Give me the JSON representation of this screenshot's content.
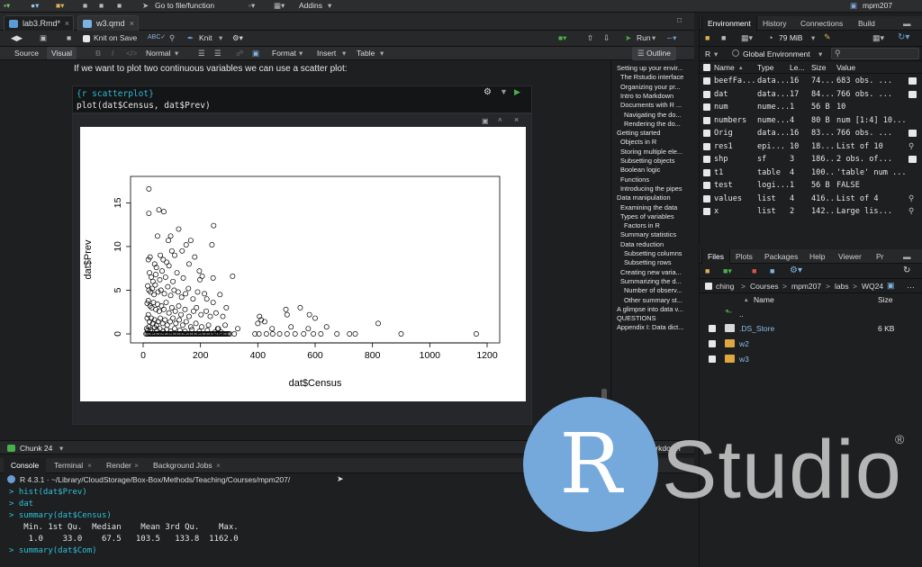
{
  "topbar": {
    "goto_label": "Go to file/function",
    "addins_label": "Addins",
    "project_label": "mpm207"
  },
  "editor": {
    "tabs": [
      {
        "label": "lab3.Rmd*"
      },
      {
        "label": "w3.qmd"
      }
    ],
    "toolbar": {
      "knit_on_save": "Knit on Save",
      "knit": "Knit",
      "run": "Run"
    },
    "toolbar2": {
      "source": "Source",
      "visual": "Visual",
      "normal": "Normal",
      "format": "Format",
      "insert": "Insert",
      "table": "Table",
      "outline": "Outline"
    },
    "doc_text": "If we want to plot two continuous variables we can use a scatter plot:",
    "chunk_header": "{r scatterplot}",
    "chunk_code": "plot(dat$Census, dat$Prev)"
  },
  "outline": [
    {
      "label": "Setting up your envir...",
      "level": 1
    },
    {
      "label": "The Rstudio interface",
      "level": 2
    },
    {
      "label": "Organizing your pr...",
      "level": 2
    },
    {
      "label": "Intro to Markdown",
      "level": 2
    },
    {
      "label": "Documents with R ...",
      "level": 2
    },
    {
      "label": "Navigating the do...",
      "level": 3
    },
    {
      "label": "Rendering the do...",
      "level": 3
    },
    {
      "label": "Getting started",
      "level": 1
    },
    {
      "label": "Objects in R",
      "level": 2
    },
    {
      "label": "Storing multiple ele...",
      "level": 2
    },
    {
      "label": "Subsetting objects",
      "level": 2
    },
    {
      "label": "Boolean logic",
      "level": 2
    },
    {
      "label": "Functions",
      "level": 2
    },
    {
      "label": "Introducing the pipes",
      "level": 2
    },
    {
      "label": "Data manipulation",
      "level": 1
    },
    {
      "label": "Examining the data",
      "level": 2
    },
    {
      "label": "Types of variables",
      "level": 2
    },
    {
      "label": "Factors in R",
      "level": 3
    },
    {
      "label": "Summary statistics",
      "level": 2
    },
    {
      "label": "Data reduction",
      "level": 2
    },
    {
      "label": "Subsetting columns",
      "level": 3
    },
    {
      "label": "Subsetting rows",
      "level": 3
    },
    {
      "label": "Creating new varia...",
      "level": 2
    },
    {
      "label": "Summarizing the d...",
      "level": 2
    },
    {
      "label": "Number of observ...",
      "level": 3
    },
    {
      "label": "Other summary st...",
      "level": 3
    },
    {
      "label": "A glimpse into data v...",
      "level": 1
    },
    {
      "label": "QUESTIONS",
      "level": 1
    },
    {
      "label": "Appendix I: Data dict...",
      "level": 1
    }
  ],
  "status": {
    "chunk": "Chunk 24",
    "mode": "R Markdown"
  },
  "console": {
    "tabs": [
      "Console",
      "Terminal",
      "Render",
      "Background Jobs"
    ],
    "path": "R 4.3.1 · ~/Library/CloudStorage/Box-Box/Methods/Teaching/Courses/mpm207/",
    "lines": [
      {
        "kind": "cmd",
        "text": "> hist(dat$Prev)"
      },
      {
        "kind": "cmd",
        "text": "> dat"
      },
      {
        "kind": "cmd",
        "text": "> summary(dat$Census)"
      },
      {
        "kind": "out",
        "text": "   Min. 1st Qu.  Median    Mean 3rd Qu.    Max. "
      },
      {
        "kind": "out",
        "text": "    1.0    33.0    67.5   103.5   133.8  1162.0 "
      },
      {
        "kind": "cmd",
        "text": "> summary(dat$Com)"
      }
    ]
  },
  "environment": {
    "tabs": [
      "Environment",
      "History",
      "Connections",
      "Build"
    ],
    "memory": "79 MiB",
    "lang": "R",
    "scope": "Global Environment",
    "columns": [
      "Name",
      "Type",
      "Le...",
      "Size",
      "Value"
    ],
    "rows": [
      {
        "name": "beefFa...",
        "type": "data...",
        "len": "16",
        "size": "74...",
        "value": "683 obs. ..."
      },
      {
        "name": "dat",
        "type": "data...",
        "len": "17",
        "size": "84...",
        "value": "766 obs. ..."
      },
      {
        "name": "num",
        "type": "nume...",
        "len": "1",
        "size": "56 B",
        "value": "10"
      },
      {
        "name": "numbers",
        "type": "nume...",
        "len": "4",
        "size": "80 B",
        "value": "num [1:4] 10..."
      },
      {
        "name": "Orig",
        "type": "data...",
        "len": "16",
        "size": "83...",
        "value": "766 obs. ..."
      },
      {
        "name": "res1",
        "type": "epi...",
        "len": "10",
        "size": "18...",
        "value": "List of 10"
      },
      {
        "name": "shp",
        "type": "sf",
        "len": "3",
        "size": "186...",
        "value": "2 obs. of..."
      },
      {
        "name": "t1",
        "type": "table",
        "len": "4",
        "size": "100...",
        "value": "'table' num ..."
      },
      {
        "name": "test",
        "type": "logi...",
        "len": "1",
        "size": "56 B",
        "value": "FALSE"
      },
      {
        "name": "values",
        "type": "list",
        "len": "4",
        "size": "416...",
        "value": "List of 4"
      },
      {
        "name": "x",
        "type": "list",
        "len": "2",
        "size": "142...",
        "value": "Large lis..."
      }
    ]
  },
  "files": {
    "tabs": [
      "Files",
      "Plots",
      "Packages",
      "Help",
      "Viewer",
      "Pr"
    ],
    "breadcrumb": [
      "ching",
      "Courses",
      "mpm207",
      "labs",
      "WQ24"
    ],
    "columns": [
      "Name",
      "Size"
    ],
    "up": "..",
    "items": [
      {
        "name": ".DS_Store",
        "size": "6 KB",
        "kind": "file"
      },
      {
        "name": "w2",
        "size": "",
        "kind": "folder"
      },
      {
        "name": "w3",
        "size": "",
        "kind": "folder"
      }
    ]
  },
  "logo": {
    "r": "R",
    "studio": "Studio",
    "reg": "®"
  },
  "chart_data": {
    "type": "scatter",
    "xlabel": "dat$Census",
    "ylabel": "dat$Prev",
    "xlim": [
      0,
      1200
    ],
    "ylim": [
      0,
      17
    ],
    "xticks": [
      0,
      200,
      400,
      600,
      800,
      1000,
      1200
    ],
    "yticks": [
      0,
      5,
      10,
      15
    ],
    "points": [
      [
        20,
        16.6
      ],
      [
        20,
        13.8
      ],
      [
        55,
        14.2
      ],
      [
        72,
        14.0
      ],
      [
        96,
        11.2
      ],
      [
        124,
        12.0
      ],
      [
        246,
        12.4
      ],
      [
        240,
        10.2
      ],
      [
        88,
        10.7
      ],
      [
        150,
        10.2
      ],
      [
        166,
        10.7
      ],
      [
        50,
        11.2
      ],
      [
        18,
        8.5
      ],
      [
        24,
        8.8
      ],
      [
        40,
        8.0
      ],
      [
        46,
        7.6
      ],
      [
        60,
        9.0
      ],
      [
        70,
        8.5
      ],
      [
        82,
        8.2
      ],
      [
        100,
        9.5
      ],
      [
        110,
        9.0
      ],
      [
        136,
        9.5
      ],
      [
        160,
        8.0
      ],
      [
        180,
        8.8
      ],
      [
        22,
        7.0
      ],
      [
        28,
        6.5
      ],
      [
        34,
        6.0
      ],
      [
        44,
        6.8
      ],
      [
        58,
        6.2
      ],
      [
        66,
        7.2
      ],
      [
        78,
        6.5
      ],
      [
        90,
        7.8
      ],
      [
        104,
        6.0
      ],
      [
        118,
        7.0
      ],
      [
        140,
        6.4
      ],
      [
        198,
        6.2
      ],
      [
        206,
        6.6
      ],
      [
        244,
        6.4
      ],
      [
        312,
        6.6
      ],
      [
        196,
        7.2
      ],
      [
        16,
        5.5
      ],
      [
        20,
        5.0
      ],
      [
        26,
        4.8
      ],
      [
        32,
        5.2
      ],
      [
        38,
        4.5
      ],
      [
        42,
        5.6
      ],
      [
        52,
        4.8
      ],
      [
        62,
        5.0
      ],
      [
        74,
        4.6
      ],
      [
        86,
        5.4
      ],
      [
        96,
        4.4
      ],
      [
        108,
        5.0
      ],
      [
        122,
        4.8
      ],
      [
        134,
        4.2
      ],
      [
        148,
        4.6
      ],
      [
        158,
        5.2
      ],
      [
        174,
        4.0
      ],
      [
        190,
        4.8
      ],
      [
        214,
        4.6
      ],
      [
        222,
        4.0
      ],
      [
        268,
        4.5
      ],
      [
        244,
        3.6
      ],
      [
        290,
        3.0
      ],
      [
        14,
        3.5
      ],
      [
        18,
        3.8
      ],
      [
        24,
        3.2
      ],
      [
        30,
        3.0
      ],
      [
        36,
        3.6
      ],
      [
        44,
        2.8
      ],
      [
        50,
        3.4
      ],
      [
        56,
        2.6
      ],
      [
        64,
        3.2
      ],
      [
        72,
        2.8
      ],
      [
        80,
        3.6
      ],
      [
        90,
        2.4
      ],
      [
        100,
        3.0
      ],
      [
        112,
        2.6
      ],
      [
        124,
        3.2
      ],
      [
        132,
        2.2
      ],
      [
        146,
        2.8
      ],
      [
        160,
        2.0
      ],
      [
        176,
        2.6
      ],
      [
        186,
        3.0
      ],
      [
        202,
        2.2
      ],
      [
        220,
        2.6
      ],
      [
        234,
        2.0
      ],
      [
        254,
        2.4
      ],
      [
        278,
        2.0
      ],
      [
        14,
        1.8
      ],
      [
        18,
        2.2
      ],
      [
        22,
        1.4
      ],
      [
        28,
        1.8
      ],
      [
        34,
        1.2
      ],
      [
        40,
        1.6
      ],
      [
        46,
        1.0
      ],
      [
        52,
        1.4
      ],
      [
        60,
        1.8
      ],
      [
        68,
        1.2
      ],
      [
        76,
        1.6
      ],
      [
        84,
        1.0
      ],
      [
        94,
        1.4
      ],
      [
        104,
        1.8
      ],
      [
        114,
        1.2
      ],
      [
        126,
        1.6
      ],
      [
        138,
        1.0
      ],
      [
        150,
        1.4
      ],
      [
        166,
        0.8
      ],
      [
        184,
        1.2
      ],
      [
        204,
        0.8
      ],
      [
        228,
        1.0
      ],
      [
        260,
        0.6
      ],
      [
        286,
        1.0
      ],
      [
        330,
        0.6
      ],
      [
        12,
        0.6
      ],
      [
        16,
        0.4
      ],
      [
        20,
        0.8
      ],
      [
        26,
        0.5
      ],
      [
        32,
        0.3
      ],
      [
        40,
        0.7
      ],
      [
        48,
        0.4
      ],
      [
        58,
        0.6
      ],
      [
        70,
        0.3
      ],
      [
        82,
        0.5
      ],
      [
        96,
        0.3
      ],
      [
        110,
        0.6
      ],
      [
        128,
        0.4
      ],
      [
        146,
        0.3
      ],
      [
        170,
        0.5
      ],
      [
        196,
        0.3
      ],
      [
        224,
        0.4
      ],
      [
        250,
        0.2
      ],
      [
        10,
        0
      ],
      [
        14,
        0
      ],
      [
        18,
        0
      ],
      [
        22,
        0
      ],
      [
        26,
        0
      ],
      [
        30,
        0
      ],
      [
        34,
        0
      ],
      [
        38,
        0
      ],
      [
        42,
        0
      ],
      [
        46,
        0
      ],
      [
        50,
        0
      ],
      [
        54,
        0
      ],
      [
        58,
        0
      ],
      [
        62,
        0
      ],
      [
        66,
        0
      ],
      [
        70,
        0
      ],
      [
        74,
        0
      ],
      [
        78,
        0
      ],
      [
        82,
        0
      ],
      [
        86,
        0
      ],
      [
        90,
        0
      ],
      [
        94,
        0
      ],
      [
        98,
        0
      ],
      [
        102,
        0
      ],
      [
        106,
        0
      ],
      [
        110,
        0
      ],
      [
        114,
        0
      ],
      [
        118,
        0
      ],
      [
        122,
        0
      ],
      [
        126,
        0
      ],
      [
        130,
        0
      ],
      [
        134,
        0
      ],
      [
        138,
        0
      ],
      [
        142,
        0
      ],
      [
        146,
        0
      ],
      [
        150,
        0
      ],
      [
        154,
        0
      ],
      [
        158,
        0
      ],
      [
        162,
        0
      ],
      [
        166,
        0
      ],
      [
        170,
        0
      ],
      [
        174,
        0
      ],
      [
        178,
        0
      ],
      [
        182,
        0
      ],
      [
        186,
        0
      ],
      [
        190,
        0
      ],
      [
        194,
        0
      ],
      [
        198,
        0
      ],
      [
        202,
        0
      ],
      [
        206,
        0
      ],
      [
        210,
        0
      ],
      [
        214,
        0
      ],
      [
        218,
        0
      ],
      [
        222,
        0
      ],
      [
        226,
        0
      ],
      [
        230,
        0
      ],
      [
        234,
        0
      ],
      [
        238,
        0
      ],
      [
        242,
        0
      ],
      [
        246,
        0
      ],
      [
        250,
        0
      ],
      [
        254,
        0
      ],
      [
        258,
        0
      ],
      [
        262,
        0
      ],
      [
        266,
        0
      ],
      [
        270,
        0
      ],
      [
        274,
        0
      ],
      [
        278,
        0
      ],
      [
        282,
        0
      ],
      [
        286,
        0
      ],
      [
        290,
        0
      ],
      [
        294,
        0
      ],
      [
        298,
        0
      ],
      [
        302,
        0
      ],
      [
        318,
        0
      ],
      [
        390,
        0
      ],
      [
        404,
        0
      ],
      [
        430,
        0
      ],
      [
        452,
        0
      ],
      [
        476,
        0
      ],
      [
        502,
        0
      ],
      [
        530,
        0
      ],
      [
        560,
        0
      ],
      [
        594,
        0
      ],
      [
        620,
        0
      ],
      [
        676,
        0
      ],
      [
        720,
        0
      ],
      [
        740,
        0
      ],
      [
        900,
        0
      ],
      [
        1162,
        0
      ],
      [
        262,
        0.6
      ],
      [
        272,
        0.2
      ],
      [
        400,
        1.2
      ],
      [
        412,
        1.6
      ],
      [
        424,
        1.4
      ],
      [
        450,
        0.6
      ],
      [
        502,
        2.2
      ],
      [
        516,
        0.8
      ],
      [
        548,
        3.0
      ],
      [
        576,
        0.6
      ],
      [
        580,
        2.2
      ],
      [
        600,
        1.8
      ],
      [
        640,
        0.8
      ],
      [
        820,
        1.2
      ],
      [
        406,
        2.0
      ],
      [
        498,
        2.8
      ]
    ]
  }
}
